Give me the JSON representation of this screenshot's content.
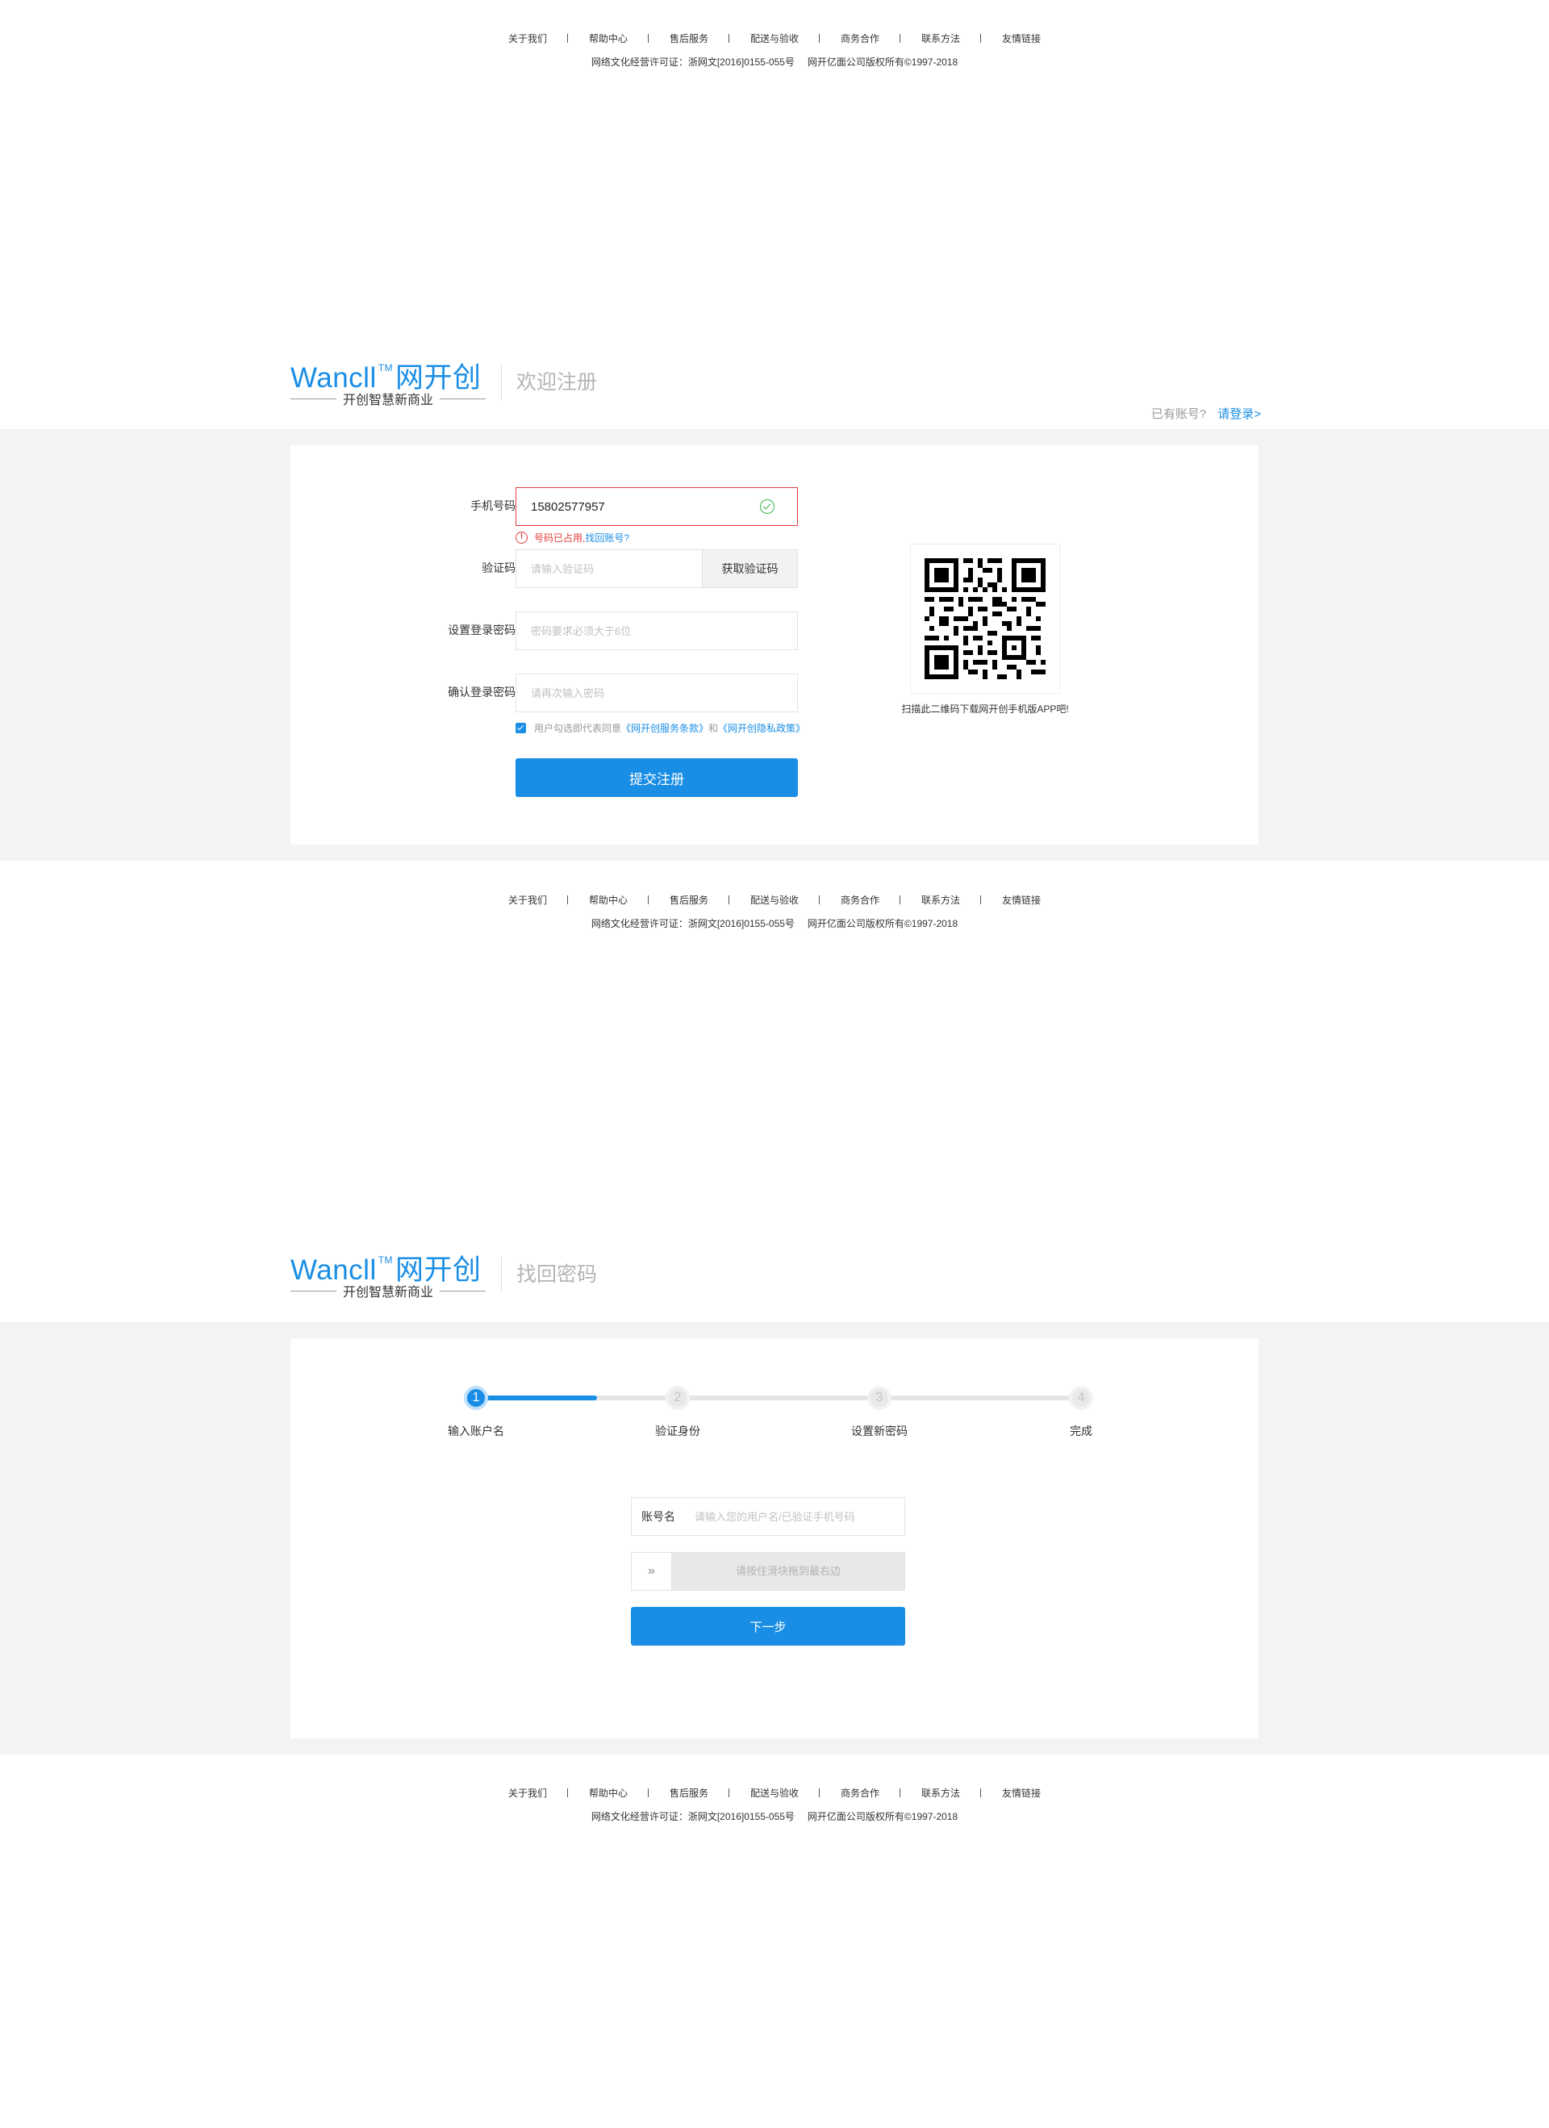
{
  "footer": {
    "links": [
      "关于我们",
      "帮助中心",
      "售后服务",
      "配送与验收",
      "商务合作",
      "联系方法",
      "友情链接"
    ],
    "license": "网络文化经营许可证：浙网文[2016]0155-055号",
    "copyright": "网开亿面公司版权所有©1997-2018"
  },
  "brand": {
    "name_latin": "Wancll",
    "trademark": "TM",
    "name_cn": "网开创",
    "slogan": "开创智慧新商业"
  },
  "register": {
    "page_title": "欢迎注册",
    "has_account_text": "已有账号?",
    "login_link": "请登录>",
    "phone_label": "手机号码:",
    "phone_value": "15802577957",
    "phone_error": "号码已占用,",
    "phone_error_link": "找回账号?",
    "code_label": "验证码:",
    "code_placeholder": "请输入验证码",
    "get_code_button": "获取验证码",
    "password_label": "设置登录密码:",
    "password_placeholder": "密码要求必须大于6位",
    "confirm_label": "确认登录密码:",
    "confirm_placeholder": "请再次输入密码",
    "agree_prefix": "用户勾选即代表同意",
    "terms_link": "《网开创服务条款》",
    "agree_and": "和",
    "privacy_link": "《网开创隐私政策》",
    "submit_button": "提交注册",
    "qr_caption": "扫描此二维码下载网开创手机版APP吧!"
  },
  "recover": {
    "page_title": "找回密码",
    "steps": [
      {
        "number": "1",
        "label": "输入账户名"
      },
      {
        "number": "2",
        "label": "验证身份"
      },
      {
        "number": "3",
        "label": "设置新密码"
      },
      {
        "number": "4",
        "label": "完成"
      }
    ],
    "current_step": 1,
    "account_label": "账号名",
    "account_placeholder": "请输入您的用户名/已验证手机号码",
    "slider_handle": "»",
    "slider_text": "请按住滑块拖到最右边",
    "next_button": "下一步"
  },
  "colors": {
    "accent": "#1a8ee5",
    "error": "#e23c3c",
    "success": "#33b549",
    "band": "#f3f3f3"
  }
}
